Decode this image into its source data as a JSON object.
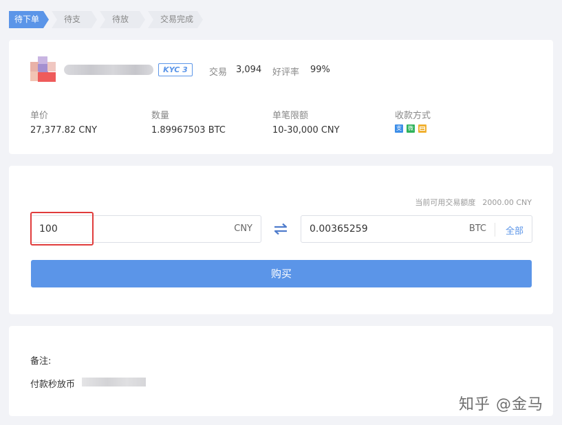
{
  "steps": [
    {
      "label": "待下单",
      "active": true
    },
    {
      "label": "待支付",
      "active": false
    },
    {
      "label": "待放币",
      "active": false
    },
    {
      "label": "交易完成",
      "active": false
    }
  ],
  "merchant": {
    "kyc_badge": "KYC 3",
    "trades_label": "交易",
    "trades_value": "3,094",
    "rating_label": "好评率",
    "rating_value": "99%"
  },
  "offer": {
    "price_label": "单价",
    "price_value": "27,377.82 CNY",
    "quantity_label": "数量",
    "quantity_value": "1.89967503 BTC",
    "limit_label": "单笔限额",
    "limit_value": "10-30,000 CNY",
    "payment_label": "收款方式",
    "payment_icons": [
      {
        "name": "alipay-icon",
        "glyph": "支",
        "color": "#3d8ee8"
      },
      {
        "name": "wechat-pay-icon",
        "glyph": "微",
        "color": "#2fb35b"
      },
      {
        "name": "bank-card-icon",
        "glyph": "",
        "color": "#f0b030"
      }
    ]
  },
  "trade": {
    "available_label": "当前可用交易额度",
    "available_value": "2000.00 CNY",
    "cny_amount": "100",
    "cny_unit": "CNY",
    "btc_amount": "0.00365259",
    "btc_unit": "BTC",
    "all_label": "全部",
    "buy_label": "购买"
  },
  "note": {
    "title": "备注:",
    "text": "付款秒放币"
  },
  "watermark": "知乎 @金马",
  "colors": {
    "accent": "#5b95e8",
    "highlight": "#e03b3b"
  }
}
